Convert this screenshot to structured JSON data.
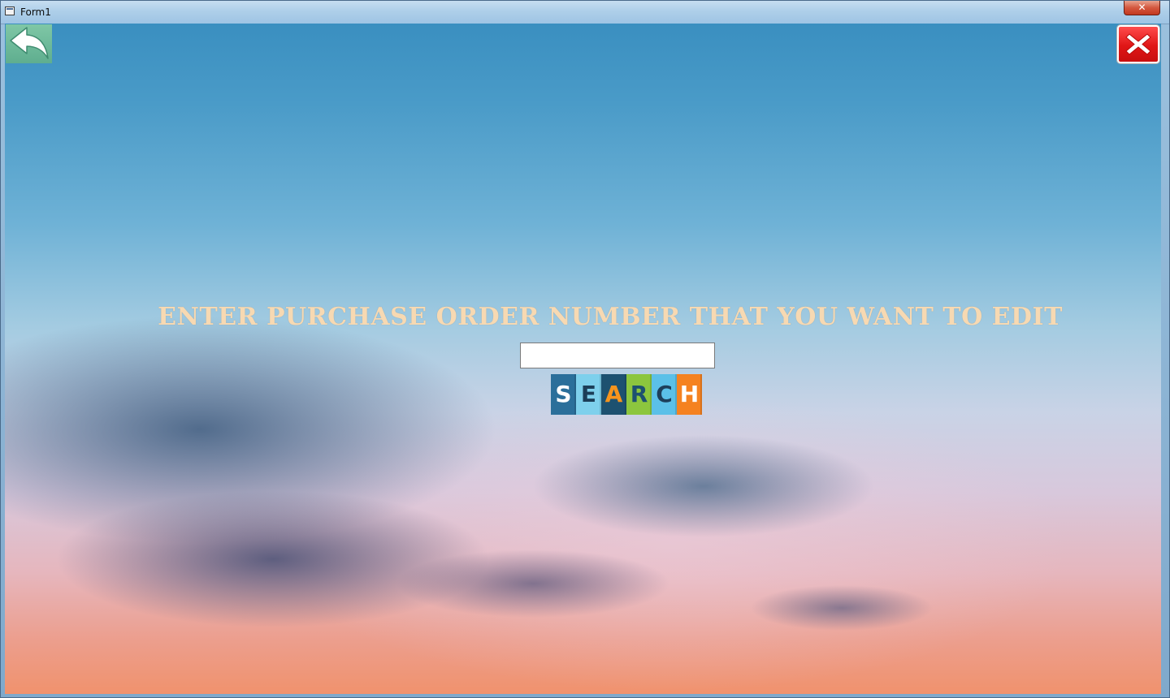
{
  "window": {
    "title": "Form1",
    "os_close_glyph": "✕"
  },
  "icons": {
    "back": "back-arrow-icon",
    "close": "close-x-icon",
    "app": "window-app-icon"
  },
  "main": {
    "heading": "ENTER PURCHASE ORDER NUMBER THAT YOU WANT TO EDIT",
    "po_input": {
      "value": "",
      "placeholder": ""
    },
    "search_button": {
      "tiles": [
        {
          "letter": "S",
          "bg": "#2b6f9a",
          "fg": "#ffffff"
        },
        {
          "letter": "E",
          "bg": "#7ed0ec",
          "fg": "#1c3e58"
        },
        {
          "letter": "A",
          "bg": "#1d5170",
          "fg": "#f7941d"
        },
        {
          "letter": "R",
          "bg": "#8cc63e",
          "fg": "#1d5170"
        },
        {
          "letter": "C",
          "bg": "#5bc0e8",
          "fg": "#1d3f5b"
        },
        {
          "letter": "H",
          "bg": "#f58220",
          "fg": "#ffffff"
        }
      ]
    }
  },
  "colors": {
    "heading": "#f7d9b2",
    "back_button_bg": "#6ab898",
    "close_button_bg": "#e01616"
  }
}
